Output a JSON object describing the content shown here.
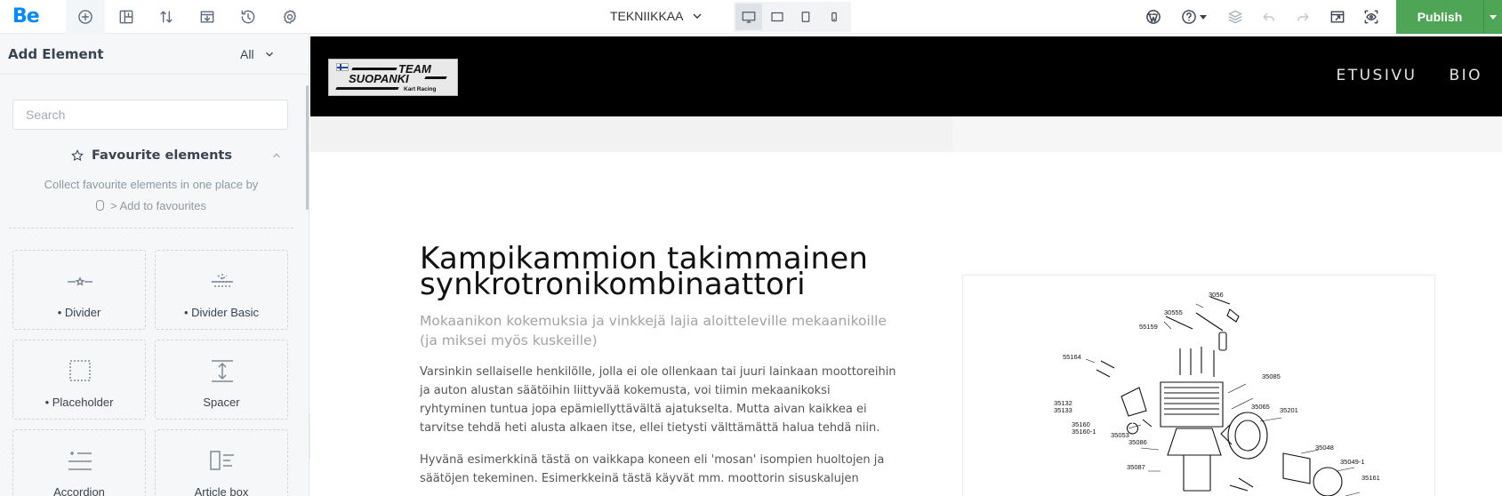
{
  "toolbar": {
    "logo": "Be",
    "page_select": "TEKNIIKKAA",
    "publish_label": "Publish"
  },
  "sidebar": {
    "title": "Add Element",
    "filter": "All",
    "search_placeholder": "Search",
    "favourites": {
      "title": "Favourite elements",
      "desc_line1": "Collect favourite elements in one place by",
      "desc_line2": "> Add to favourites"
    },
    "elements": [
      {
        "label": "• Divider",
        "icon": "divider-icon"
      },
      {
        "label": "• Divider Basic",
        "icon": "divider-basic-icon"
      },
      {
        "label": "• Placeholder",
        "icon": "placeholder-icon"
      },
      {
        "label": "Spacer",
        "icon": "spacer-icon"
      },
      {
        "label": "Accordion",
        "icon": "accordion-icon"
      },
      {
        "label": "Article box",
        "icon": "article-box-icon"
      }
    ]
  },
  "site": {
    "logo_text_1": "TEAM",
    "logo_text_2": "SUOPANKI",
    "logo_text_3": "Kart Racing",
    "nav": [
      "ETUSIVU",
      "BIO"
    ],
    "article": {
      "title_line1": "Kampikammion takimmainen",
      "title_line2": "synkrotronikombinaattori",
      "subtitle": "Mokaanikon kokemuksia ja vinkkejä lajia aloitteleville mekaanikoille (ja miksei myös kuskeille)",
      "p1": "Varsinkin sellaiselle henkilölle, jolla ei ole ollenkaan tai juuri lainkaan moottoreihin ja auton alustan säätöihin liittyvää kokemusta, voi tiimin mekaanikoksi ryhtyminen tuntua jopa epämiellyttävältä ajatukselta. Mutta aivan kaikkea ei tarvitse tehdä heti alusta alkaen itse, ellei tietysti välttämättä halua tehdä niin.",
      "p2": "Hyvänä esimerkkinä tästä on vaikkapa koneen eli 'mosan' isompien huoltojen ja säätöjen tekeminen. Esimerkkeinä tästä käyvät mm. moottorin sisuskalujen"
    },
    "diagram_labels": [
      "3056",
      "30555",
      "55159",
      "55164",
      "35085",
      "35065",
      "35201",
      "35132",
      "35133",
      "35160",
      "35160-1",
      "35053",
      "35086",
      "35087",
      "35048",
      "35049-1",
      "35161"
    ]
  },
  "colors": {
    "accent": "#0089f7",
    "publish": "#4fa556"
  }
}
